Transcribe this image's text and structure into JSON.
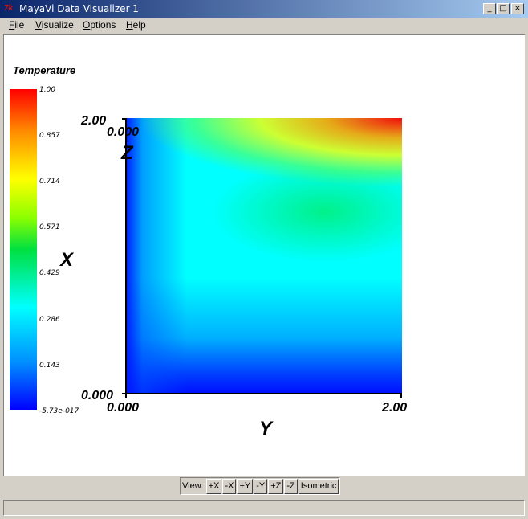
{
  "window": {
    "icon": "tk-icon",
    "title": "MayaVi Data Visualizer 1",
    "minimize": "_",
    "maximize": "□",
    "close": "×"
  },
  "menu": [
    "File",
    "Visualize",
    "Options",
    "Help"
  ],
  "legend": {
    "title": "Temperature",
    "ticks": [
      "1.00",
      "0.857",
      "0.714",
      "0.571",
      "0.429",
      "0.286",
      "0.143",
      "-5.73e-017"
    ]
  },
  "axes": {
    "x_title": "X",
    "y_title": "Y",
    "z_title": "Z",
    "x_min": "0.000",
    "x_max": "2.00",
    "y_min": "0.000",
    "y_max": "2.00",
    "z_label": "0.000"
  },
  "view_toolbar": {
    "label": "View:",
    "buttons": [
      "+X",
      "-X",
      "+Y",
      "-Y",
      "+Z",
      "-Z",
      "Isometric"
    ]
  },
  "status": "",
  "colors": {
    "titlebar_start": "#0a246a",
    "titlebar_end": "#a6caf0",
    "colormap_high": "#ff0000",
    "colormap_low": "#0000ff"
  }
}
